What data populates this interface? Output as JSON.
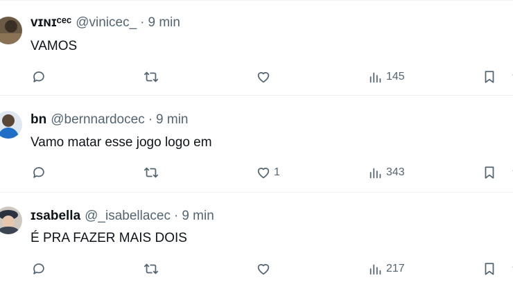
{
  "tweets": [
    {
      "name": "ᴠɪɴɪᶜᵉᶜ",
      "handle": "@vinicec_",
      "separator": "·",
      "time": "9 min",
      "text": "VAMOS",
      "likes": "",
      "views": "145"
    },
    {
      "name": "bn",
      "handle": "@bernnardocec",
      "separator": "·",
      "time": "9 min",
      "text": "Vamo matar esse jogo logo em",
      "likes": "1",
      "views": "343"
    },
    {
      "name": "ɪsabella",
      "handle": "@_isabellacec",
      "separator": "·",
      "time": "9 min",
      "text": "É PRA FAZER MAIS DOIS",
      "likes": "",
      "views": "217"
    }
  ],
  "icons": {
    "reply": "reply-icon",
    "retweet": "retweet-icon",
    "like": "heart-icon",
    "views": "views-chart-icon",
    "bookmark": "bookmark-icon"
  },
  "colors": {
    "text": "#0f1419",
    "muted": "#536471",
    "divider": "#eff3f4"
  }
}
